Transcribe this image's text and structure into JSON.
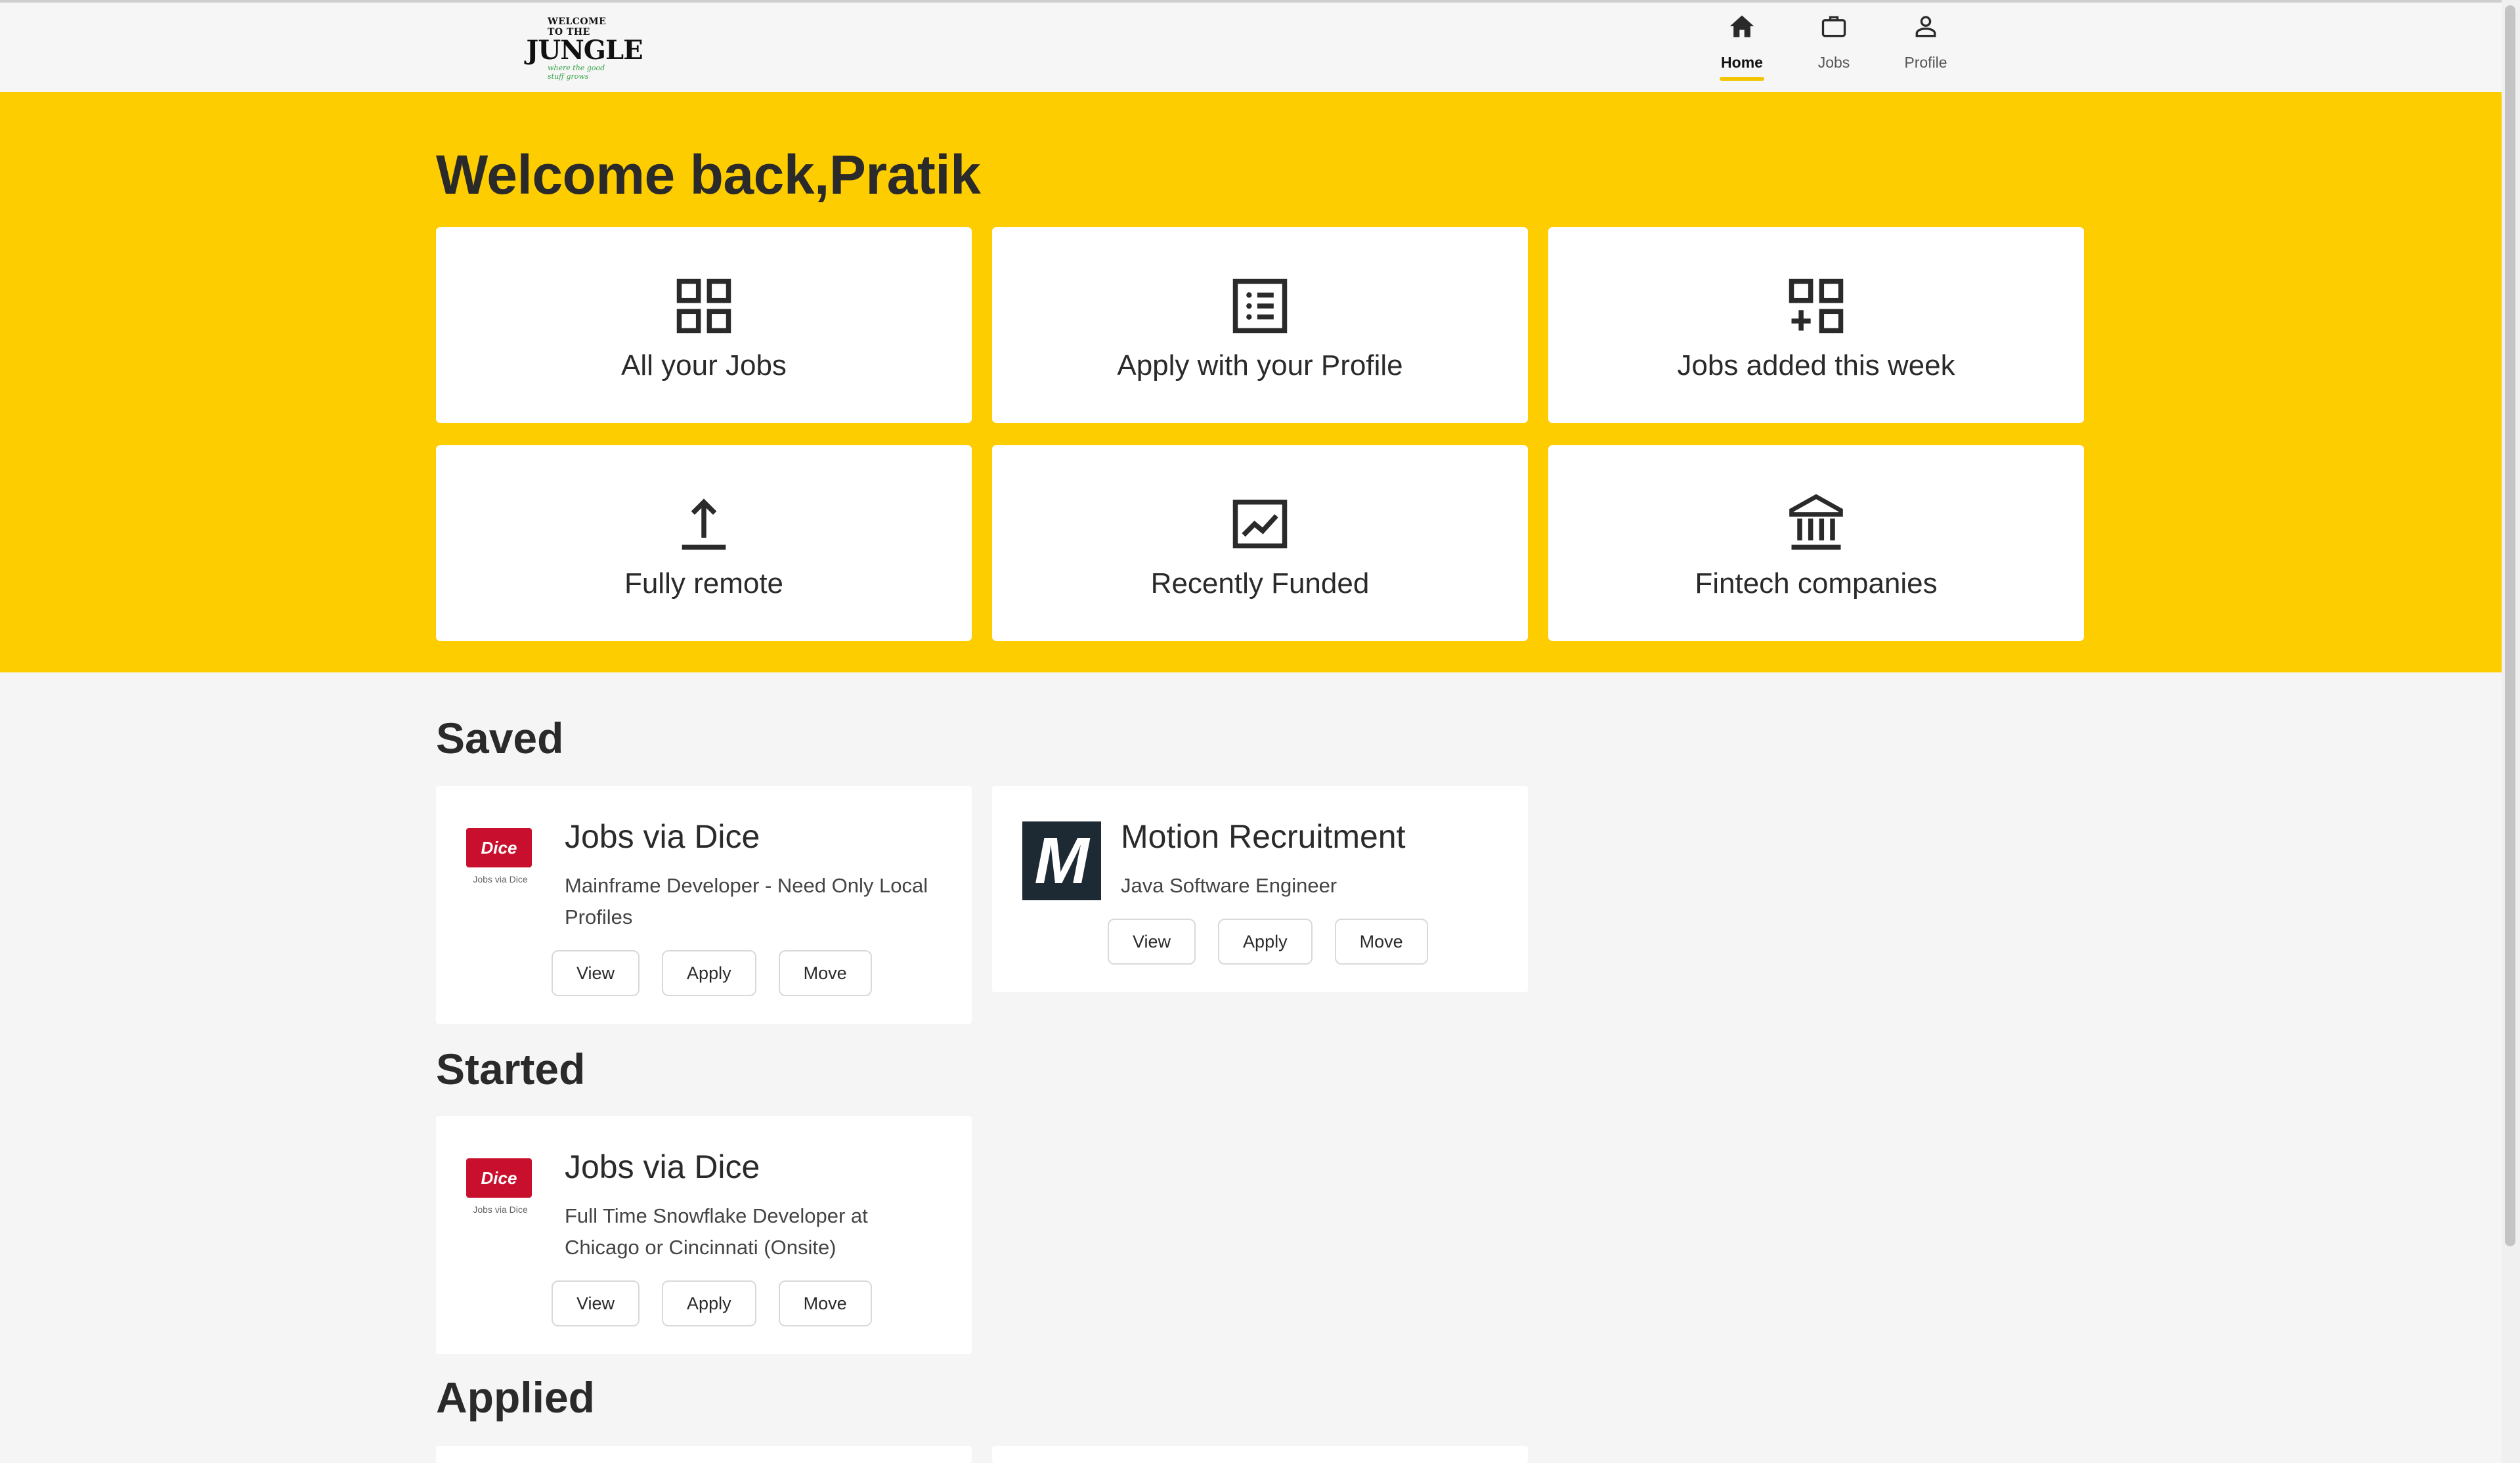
{
  "header": {
    "logo": {
      "line1": "WELCOME TO THE",
      "line2": "JUNGLE",
      "line3": "where the good stuff grows"
    },
    "nav": [
      {
        "label": "Home",
        "icon": "home-icon",
        "active": true
      },
      {
        "label": "Jobs",
        "icon": "briefcase-icon",
        "active": false
      },
      {
        "label": "Profile",
        "icon": "person-icon",
        "active": false
      }
    ]
  },
  "hero": {
    "welcome": "Welcome back,Pratik",
    "tiles": [
      {
        "label": "All your Jobs",
        "icon": "grid-icon"
      },
      {
        "label": "Apply with your Profile",
        "icon": "list-icon"
      },
      {
        "label": "Jobs added this week",
        "icon": "grid-plus-icon"
      },
      {
        "label": "Fully remote",
        "icon": "upload-icon"
      },
      {
        "label": "Recently Funded",
        "icon": "chart-line-icon"
      },
      {
        "label": "Fintech companies",
        "icon": "bank-icon"
      }
    ]
  },
  "sections": {
    "saved": {
      "title": "Saved",
      "cards": [
        {
          "company": "Jobs via Dice",
          "role": "Mainframe Developer - Need Only Local Profiles",
          "logo_text": "Dice",
          "logo_sub": "Jobs via Dice"
        },
        {
          "company": "Motion Recruitment",
          "role": "Java Software Engineer",
          "logo_text": "M"
        }
      ]
    },
    "started": {
      "title": "Started",
      "cards": [
        {
          "company": "Jobs via Dice",
          "role": "Full Time Snowflake Developer at Chicago or Cincinnati (Onsite)",
          "logo_text": "Dice",
          "logo_sub": "Jobs via Dice"
        }
      ]
    },
    "applied": {
      "title": "Applied"
    }
  },
  "buttons": {
    "view": "View",
    "apply": "Apply",
    "move": "Move"
  },
  "colors": {
    "accent": "#fdcd00",
    "dice_red": "#c8102e",
    "motion_dark": "#1e2a33"
  }
}
